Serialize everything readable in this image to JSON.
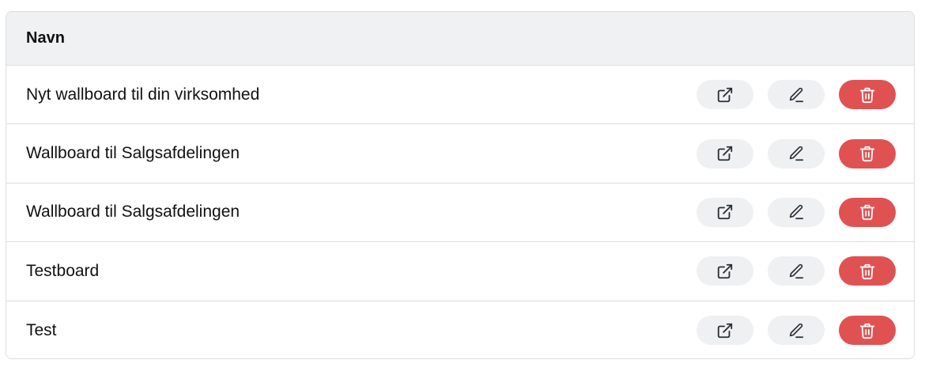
{
  "table": {
    "header": {
      "name_label": "Navn"
    },
    "rows": [
      {
        "name": "Nyt wallboard til din virksomhed"
      },
      {
        "name": "Wallboard til Salgsafdelingen"
      },
      {
        "name": "Wallboard til Salgsafdelingen"
      },
      {
        "name": "Testboard"
      },
      {
        "name": "Test"
      }
    ]
  },
  "icons": {
    "open": "external-link-icon",
    "edit": "pencil-icon",
    "delete": "trash-icon"
  },
  "colors": {
    "header_bg": "#f0f1f3",
    "neutral_button": "#eff0f2",
    "danger_button": "#e05252",
    "icon_dark": "#2b2f36",
    "icon_light": "#ffffff"
  }
}
